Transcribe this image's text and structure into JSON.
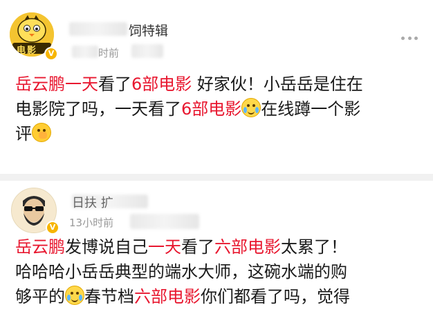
{
  "post1": {
    "username_visible": "饲特辑",
    "time": "时前",
    "verified": "V",
    "avatar_label": "电影",
    "text": {
      "line1_a": "岳云鹏一天",
      "line1_b": "看了",
      "line1_c": "6部电影",
      "line1_d": " 好家伙！小岳岳是住在",
      "line2_a": "电影院了吗，一天看了",
      "line2_b": "6部电影",
      "line2_c": "在线蹲一个影",
      "line3_a": "评"
    }
  },
  "post2": {
    "username_visible": "日扶 扩",
    "time": "13小时前",
    "verified": "V",
    "text": {
      "line1_a": "岳云鹏",
      "line1_b": "发博说自己",
      "line1_c": "一天",
      "line1_d": "看了",
      "line1_e": "六部电影",
      "line1_f": "太累了！",
      "line2": "哈哈哈小岳岳典型的端水大师，这碗水端的购",
      "line3_a": "够平的",
      "line3_b": "春节档",
      "line3_c": "六部电影",
      "line3_d": "你们都看了吗，觉得"
    }
  },
  "colors": {
    "highlight": "#e8172f",
    "badge": "#f7b500"
  },
  "icons": {
    "more": "more-dots-icon",
    "verified": "verified-badge-icon"
  }
}
